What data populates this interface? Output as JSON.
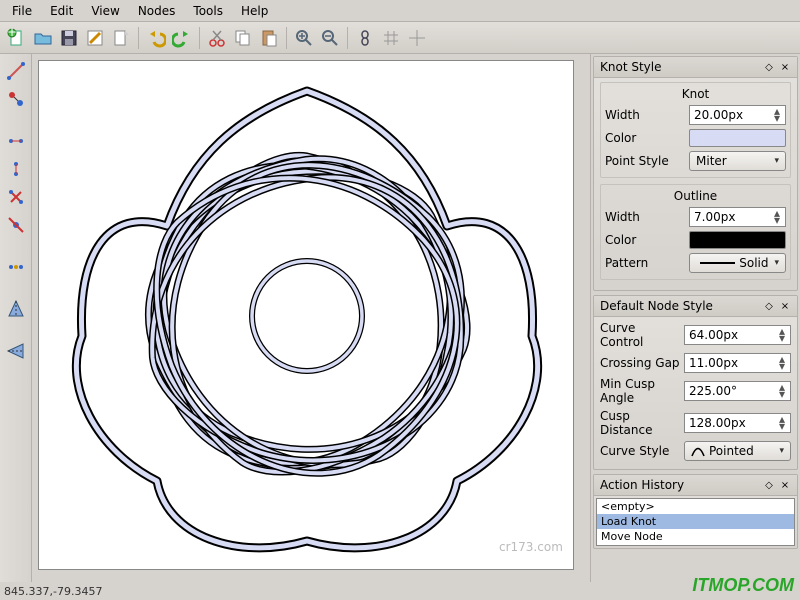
{
  "menu": [
    "File",
    "Edit",
    "View",
    "Nodes",
    "Tools",
    "Help"
  ],
  "toolbar_icons": [
    "new",
    "open",
    "save",
    "save-as",
    "export",
    "undo",
    "redo",
    "cut",
    "copy",
    "paste",
    "zoom-in",
    "zoom-out",
    "knot-plugin",
    "grid",
    "crosshair"
  ],
  "left_tool_icons": [
    "edge-tool",
    "node-tool",
    "",
    "hjoin",
    "vjoin",
    "cross",
    "delete-node",
    "",
    "arrange",
    "",
    "mirror-h",
    "",
    "mirror-v"
  ],
  "panels": {
    "knot_style": {
      "title": "Knot Style",
      "knot_label": "Knot",
      "width_label": "Width",
      "width_value": "20.00px",
      "color_label": "Color",
      "knot_color": "#d7dbf4",
      "point_style_label": "Point Style",
      "point_style_value": "Miter",
      "outline_label": "Outline",
      "outline_width_label": "Width",
      "outline_width_value": "7.00px",
      "outline_color_label": "Color",
      "outline_color": "#000000",
      "pattern_label": "Pattern",
      "pattern_value": "Solid"
    },
    "default_node_style": {
      "title": "Default Node Style",
      "curve_control_label": "Curve Control",
      "curve_control_value": "64.00px",
      "crossing_gap_label": "Crossing Gap",
      "crossing_gap_value": "11.00px",
      "min_cusp_label": "Min Cusp Angle",
      "min_cusp_value": "225.00°",
      "cusp_distance_label": "Cusp Distance",
      "cusp_distance_value": "128.00px",
      "curve_style_label": "Curve Style",
      "curve_style_value": "Pointed"
    },
    "action_history": {
      "title": "Action History",
      "items": [
        "<empty>",
        "Load Knot",
        "Move Node"
      ],
      "selected_index": 1
    }
  },
  "status_coords": "845.337,-79.3457",
  "watermark": "ITMOP.COM",
  "canvas_watermark": "cr173.com"
}
